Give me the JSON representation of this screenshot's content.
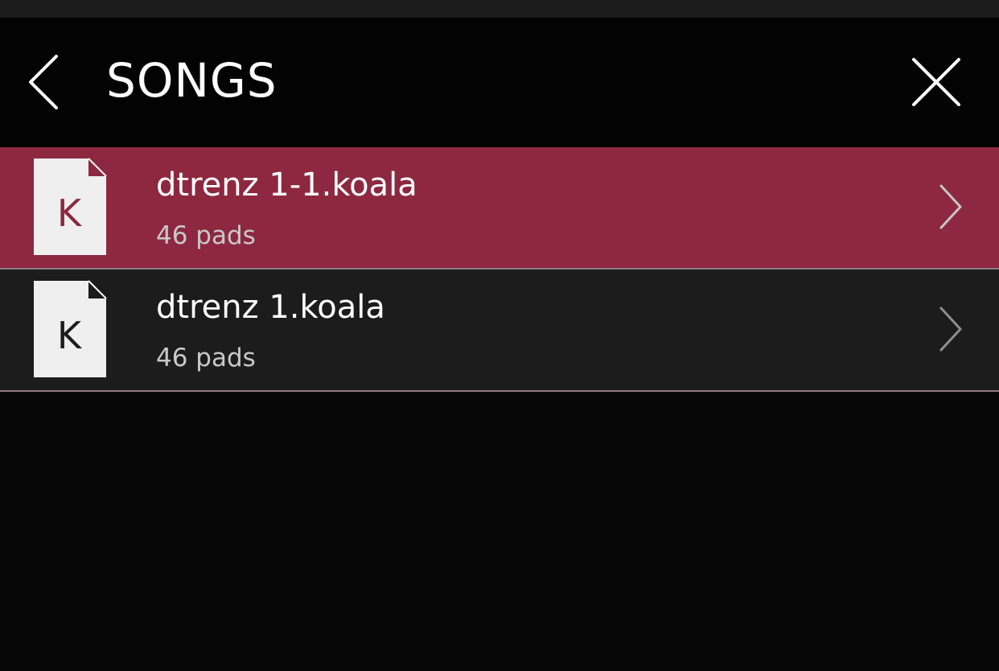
{
  "header": {
    "back_icon": "chevron-left-icon",
    "title": "SONGS",
    "close_icon": "close-icon"
  },
  "songs": [
    {
      "icon_letter": "K",
      "name": "dtrenz 1-1.koala",
      "subtitle": "46 pads",
      "selected": true,
      "chevron_icon": "chevron-right-icon"
    },
    {
      "icon_letter": "K",
      "name": "dtrenz 1.koala",
      "subtitle": "46 pads",
      "selected": false,
      "chevron_icon": "chevron-right-icon"
    }
  ],
  "colors": {
    "selected_row": "#8d2840",
    "row": "#1c1c1c",
    "background": "#060606",
    "text": "#ffffff",
    "subtext": "#c9c9c9"
  }
}
